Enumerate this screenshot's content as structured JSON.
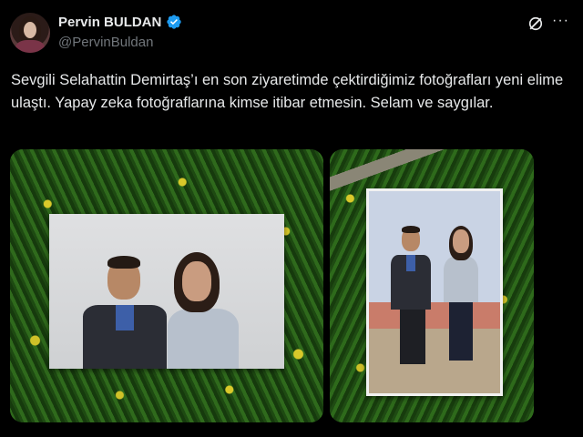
{
  "author": {
    "display_name": "Pervin BULDAN",
    "handle": "@PervinBuldan",
    "verified": true
  },
  "header_actions": {
    "grok_icon": "grok-icon",
    "more_icon": "more-icon",
    "more_label": "···"
  },
  "tweet": {
    "text": "Sevgili Selahattin Demirtaş’ı en son ziyaretimde çektirdiğimiz fotoğrafları yeni elime ulaştı. Yapay zeka fotoğraflarına kimse itibar etmesin. Selam ve saygılar."
  },
  "colors": {
    "background": "#000000",
    "text": "#e7e9ea",
    "secondary": "#71767b",
    "verified_blue": "#1d9bf0"
  }
}
